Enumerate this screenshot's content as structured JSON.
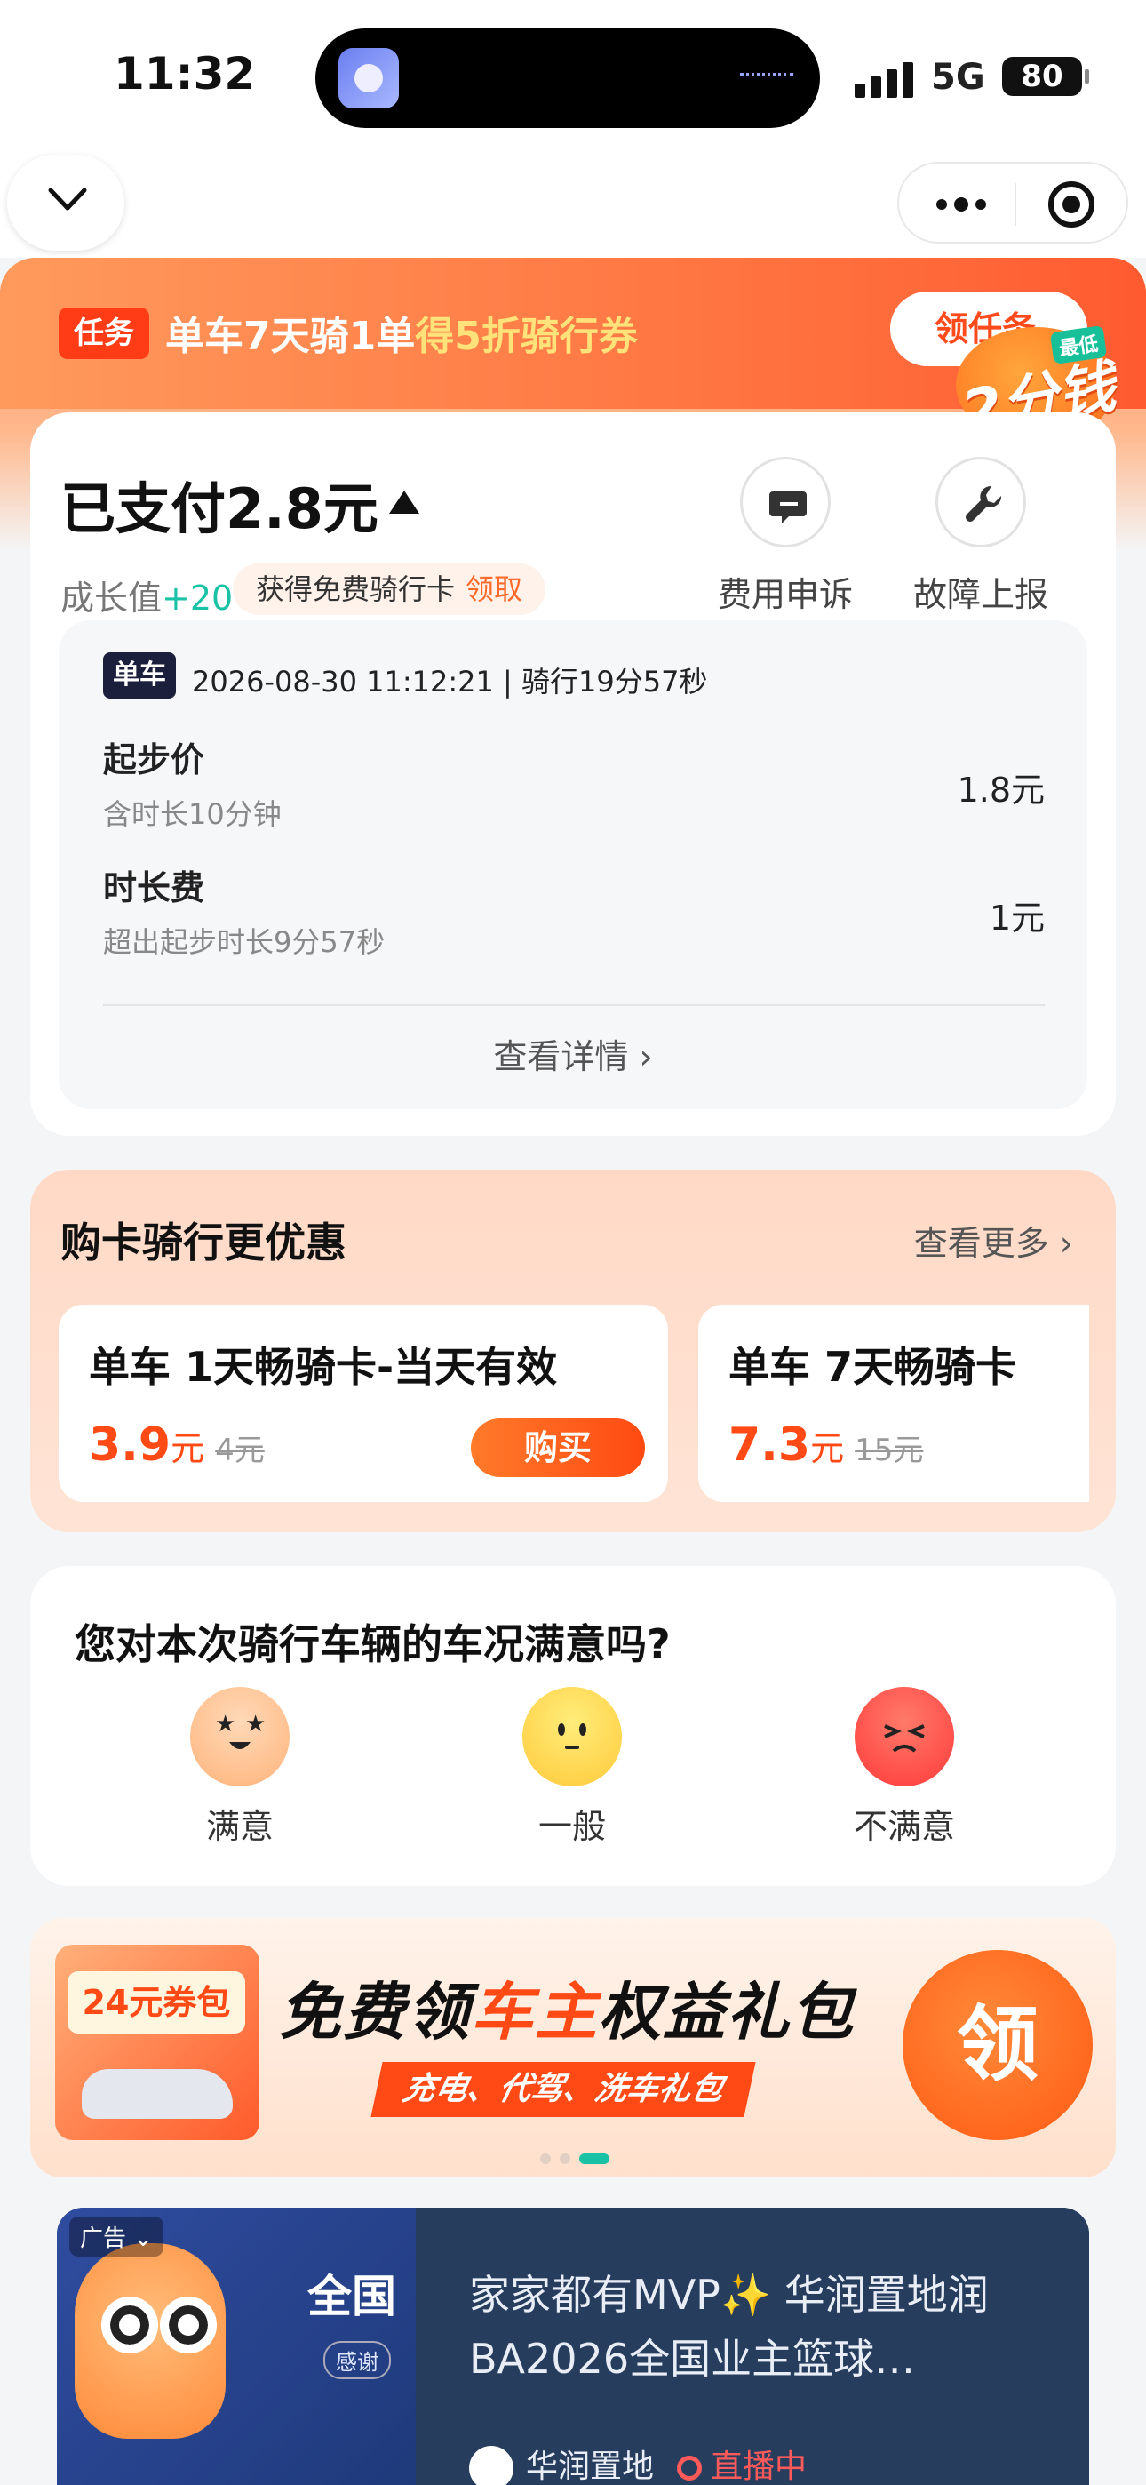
{
  "status_bar": {
    "time": "11:32",
    "network": "5G",
    "battery": "80"
  },
  "task": {
    "tag": "任务",
    "text_prefix": "单车7天骑1单",
    "text_highlight": "得5折骑行券",
    "button": "领任务",
    "coin_badge": "2分钱",
    "coin_top": "最低"
  },
  "payment": {
    "paid_label": "已支付2.8元",
    "growth_label": "成长值",
    "growth_value": "+20",
    "free_card_text": "获得免费骑行卡",
    "free_card_claim": "领取",
    "actions": [
      {
        "label": "费用申诉",
        "icon": "chat-icon"
      },
      {
        "label": "故障上报",
        "icon": "wrench-icon"
      }
    ]
  },
  "ride": {
    "type_tag": "单车",
    "meta": "2026-08-30 11:12:21 | 骑行19分57秒",
    "fees": [
      {
        "name": "起步价",
        "sub": "含时长10分钟",
        "amount": "1.8元"
      },
      {
        "name": "时长费",
        "sub": "超出起步时长9分57秒",
        "amount": "1元"
      }
    ],
    "view_detail": "查看详情"
  },
  "buy_cards": {
    "title": "购卡骑行更优惠",
    "more": "查看更多",
    "cards": [
      {
        "name": "单车 1天畅骑卡-当天有效",
        "price": "3.9",
        "unit": "元",
        "original": "4元",
        "button": "购买"
      },
      {
        "name": "单车 7天畅骑卡",
        "price": "7.3",
        "unit": "元",
        "original": "15元"
      }
    ]
  },
  "satisfaction": {
    "question": "您对本次骑行车辆的车况满意吗?",
    "options": [
      {
        "label": "满意",
        "icon": "happy-face-icon"
      },
      {
        "label": "一般",
        "icon": "neutral-face-icon"
      },
      {
        "label": "不满意",
        "icon": "angry-face-icon"
      }
    ]
  },
  "banner": {
    "coupon": "24元券包",
    "title_part1": "免费领",
    "title_highlight": "车主",
    "title_part2": "权益礼包",
    "subtitle": "充电、代驾、洗车礼包",
    "claim": "领"
  },
  "ad": {
    "tag": "广告",
    "left_title": "全国",
    "left_sub": "感谢",
    "title": "家家都有MVP✨ 华润置地润BA2026全国业主篮球…",
    "brand": "华润置地",
    "live": "直播中"
  },
  "colors": {
    "accent": "#ff4a16",
    "teal": "#19c2a5"
  }
}
